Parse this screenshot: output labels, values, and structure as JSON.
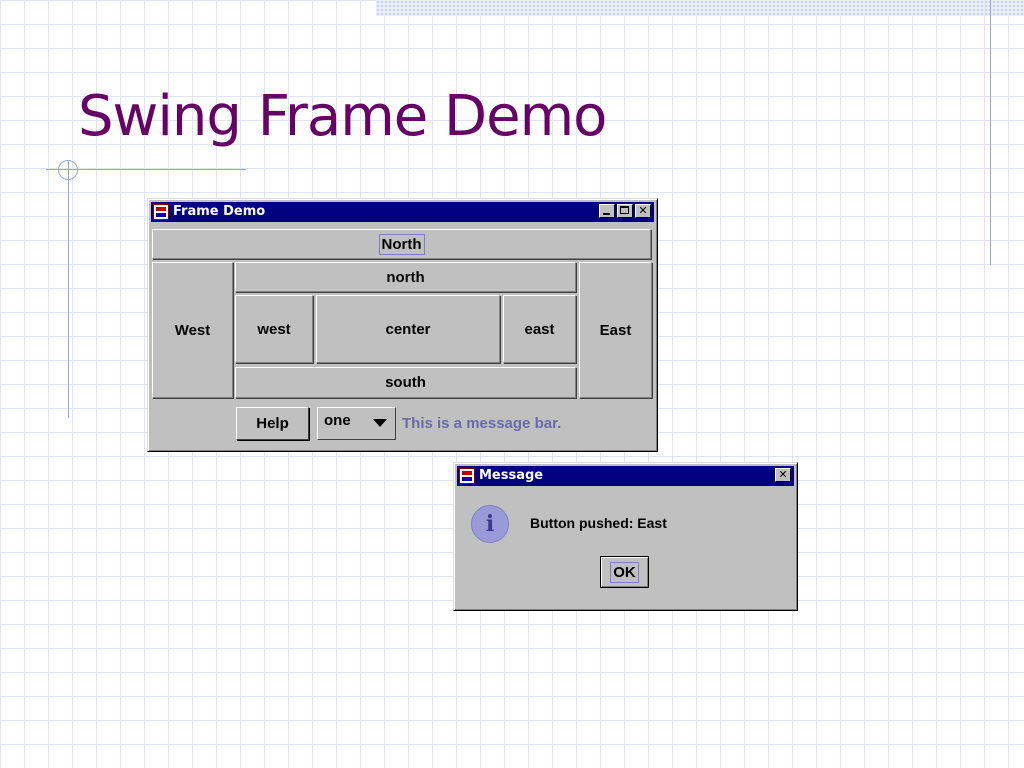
{
  "slide": {
    "title": "Swing Frame Demo"
  },
  "frame_window": {
    "title": "Frame Demo",
    "north_button": "North",
    "west_button": "West",
    "east_button": "East",
    "inner": {
      "north": "north",
      "west": "west",
      "center": "center",
      "east": "east",
      "south": "south"
    },
    "help_button": "Help",
    "combo_value": "one",
    "message_bar": "This is a message bar."
  },
  "message_dialog": {
    "title": "Message",
    "message": "Button pushed: East",
    "ok_label": "OK",
    "icon": "info-icon"
  },
  "colors": {
    "title": "#660066",
    "titlebar": "#000080",
    "window_bg": "#c0c0c0",
    "message_bar_text": "#6a6aa8"
  }
}
